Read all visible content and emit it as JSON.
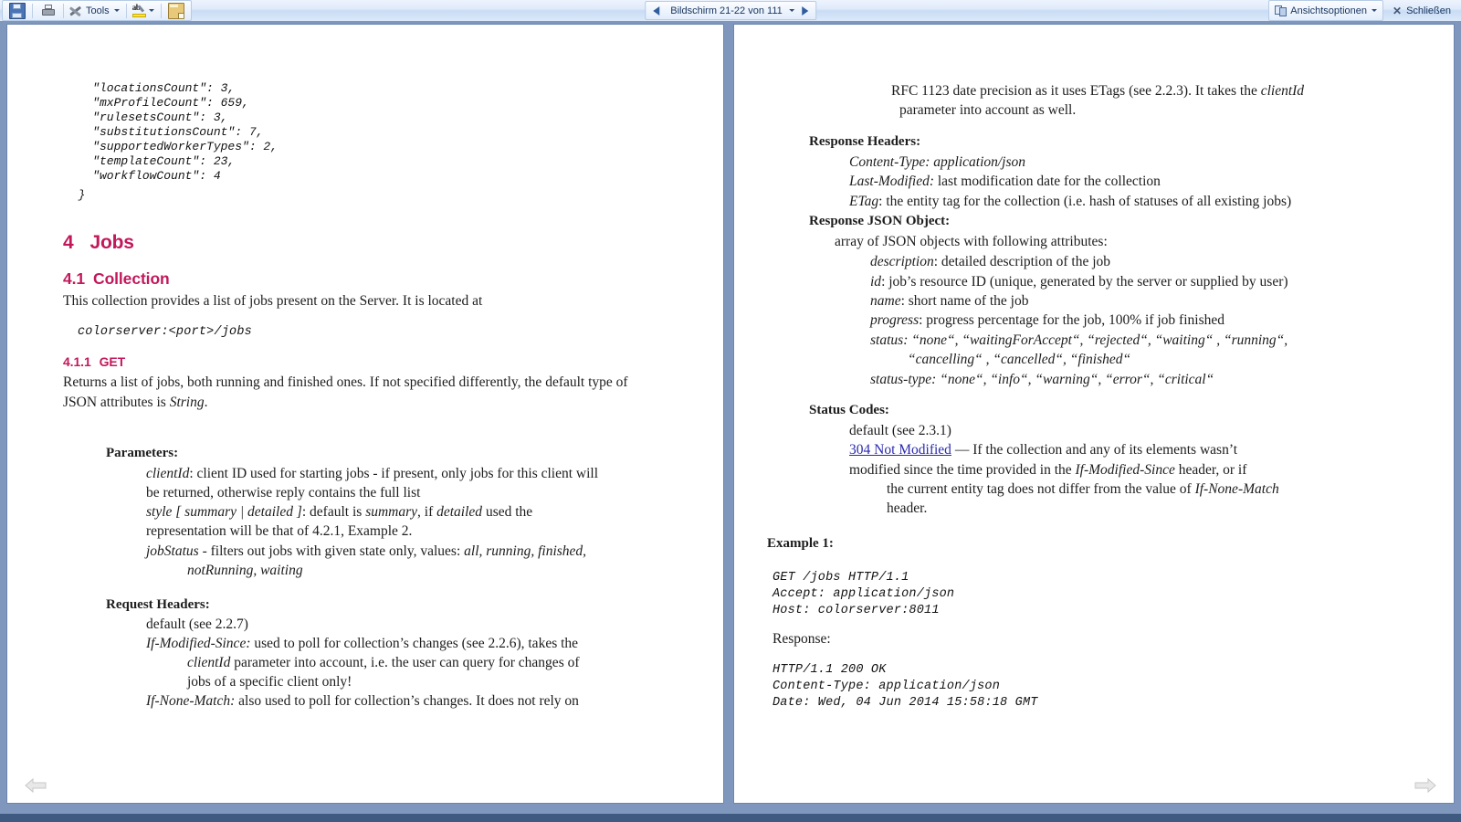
{
  "toolbar": {
    "save_tooltip": "Speichern",
    "print_tooltip": "Drucken",
    "tools_label": "Tools",
    "highlight_tooltip": "Hervorheben",
    "note_tooltip": "Notiz",
    "view_options_label": "Ansichtsoptionen",
    "close_label": "Schließen",
    "close_x": "✕",
    "nav_text": "Bildschirm 21-22 von 111"
  },
  "left_page": {
    "code_block": [
      "    \"locationsCount\": 3,",
      "    \"mxProfileCount\": 659,",
      "    \"rulesetsCount\": 3,",
      "    \"substitutionsCount\": 7,",
      "    \"supportedWorkerTypes\": 2,",
      "    \"templateCount\": 23,",
      "    \"workflowCount\": 4",
      "  }"
    ],
    "h_sec_num": "4",
    "h_sec_title": "Jobs",
    "h_sub_num": "4.1",
    "h_sub_title": "Collection",
    "intro": "This collection provides a list of jobs present on the Server. It is located at",
    "url_code": "colorserver:<port>/jobs",
    "h_sss_num": "4.1.1",
    "h_sss_title": "GET",
    "get_desc_line1": "Returns a list of jobs, both running and finished ones. If not specified differently, the default type of",
    "get_desc_line2_a": "JSON attributes is ",
    "get_desc_line2_b": "String",
    "get_desc_line2_c": ".",
    "parameters_label": "Parameters:",
    "param_clientid_name": "clientId",
    "param_clientid_l1": ": client ID used for starting jobs - if present, only jobs for this client will",
    "param_clientid_l2": "be returned, otherwise reply contains the full list",
    "param_style_name": "style [ summary | detailed ]",
    "param_style_a": ": default is ",
    "param_style_b": "summary",
    "param_style_c": ", if ",
    "param_style_d": "detailed",
    "param_style_e": " used the",
    "param_style_l2": "representation will be that of 4.2.1, Example 2.",
    "param_jobstatus_name": "jobStatus",
    "param_jobstatus_a": " -  filters out jobs with given state only, values: ",
    "param_jobstatus_b": "all, running, finished,",
    "param_jobstatus_l2": "notRunning, waiting",
    "request_headers_label": "Request Headers:",
    "rh_default": "default (see 2.2.7)",
    "rh_ims_name": "If-Modified-Since:",
    "rh_ims_l1": " used to poll for collection’s changes (see 2.2.6), takes the",
    "rh_ims_l2_a": "clientId",
    "rh_ims_l2_b": " parameter into account, i.e. the user can query for changes of",
    "rh_ims_l3": "jobs of a specific client only!",
    "rh_inm_name": "If-None-Match:",
    "rh_inm_l1": " also used to poll for collection’s changes. It does not rely on"
  },
  "right_page": {
    "cont_l1_a": "RFC 1123 date precision as it uses ETags (see 2.2.3). It takes the ",
    "cont_l1_b": "clientId",
    "cont_l2": "parameter into account as well.",
    "response_headers_label": "Response Headers:",
    "rh_ct_name": "Content-Type",
    "rh_ct_val": ": application/json",
    "rh_lm_name": "Last-Modified:",
    "rh_lm_val": " last modification date for the collection",
    "rh_et_name": "ETag",
    "rh_et_val": ": the entity tag  for the collection (i.e. hash of statuses of all existing jobs)",
    "response_json_label": "Response JSON Object:",
    "rj_intro": "array of JSON objects with following attributes:",
    "rj_desc_name": "description",
    "rj_desc_val": ":  detailed description of the job",
    "rj_id_name": "id",
    "rj_id_val": ": job’s resource ID (unique, generated by the server or supplied by user)",
    "rj_name_name": "name",
    "rj_name_val": ":  short name of the job",
    "rj_prog_name": "progress",
    "rj_prog_val": ":  progress percentage for the job, 100% if job finished",
    "rj_status_name": "status",
    "rj_status_val_l1": ":  “none“, “waitingForAccept“, “rejected“, “waiting“ , “running“,",
    "rj_status_val_l2": "“cancelling“ , “cancelled“, “finished“",
    "rj_stype_name": "status-type",
    "rj_stype_val": ": “none“, “info“, “warning“, “error“, “critical“",
    "status_codes_label": "Status Codes:",
    "sc_default": "default (see 2.3.1)",
    "sc_link": "304 Not Modified",
    "sc_l1": " — If the collection and any of its elements wasn’t",
    "sc_l2_a": "modified since the time provided in the ",
    "sc_l2_b": "If-Modified-Since",
    "sc_l2_c": " header, or if",
    "sc_l3_a": "the current entity tag does not differ from the value of ",
    "sc_l3_b": "If-None-Match",
    "sc_l4": "header.",
    "example_label": "Example 1:",
    "req_block": [
      "GET /jobs HTTP/1.1",
      "Accept: application/json",
      "Host: colorserver:8011"
    ],
    "response_label": "Response:",
    "resp_block": [
      "HTTP/1.1 200 OK",
      "Content-Type: application/json",
      "Date: Wed, 04 Jun 2014 15:58:18 GMT"
    ]
  },
  "colors": {
    "heading": "#c2185b",
    "link": "#2a2ab0",
    "chrome": "#cdd9ec",
    "page_bg": "#7f97bd"
  }
}
